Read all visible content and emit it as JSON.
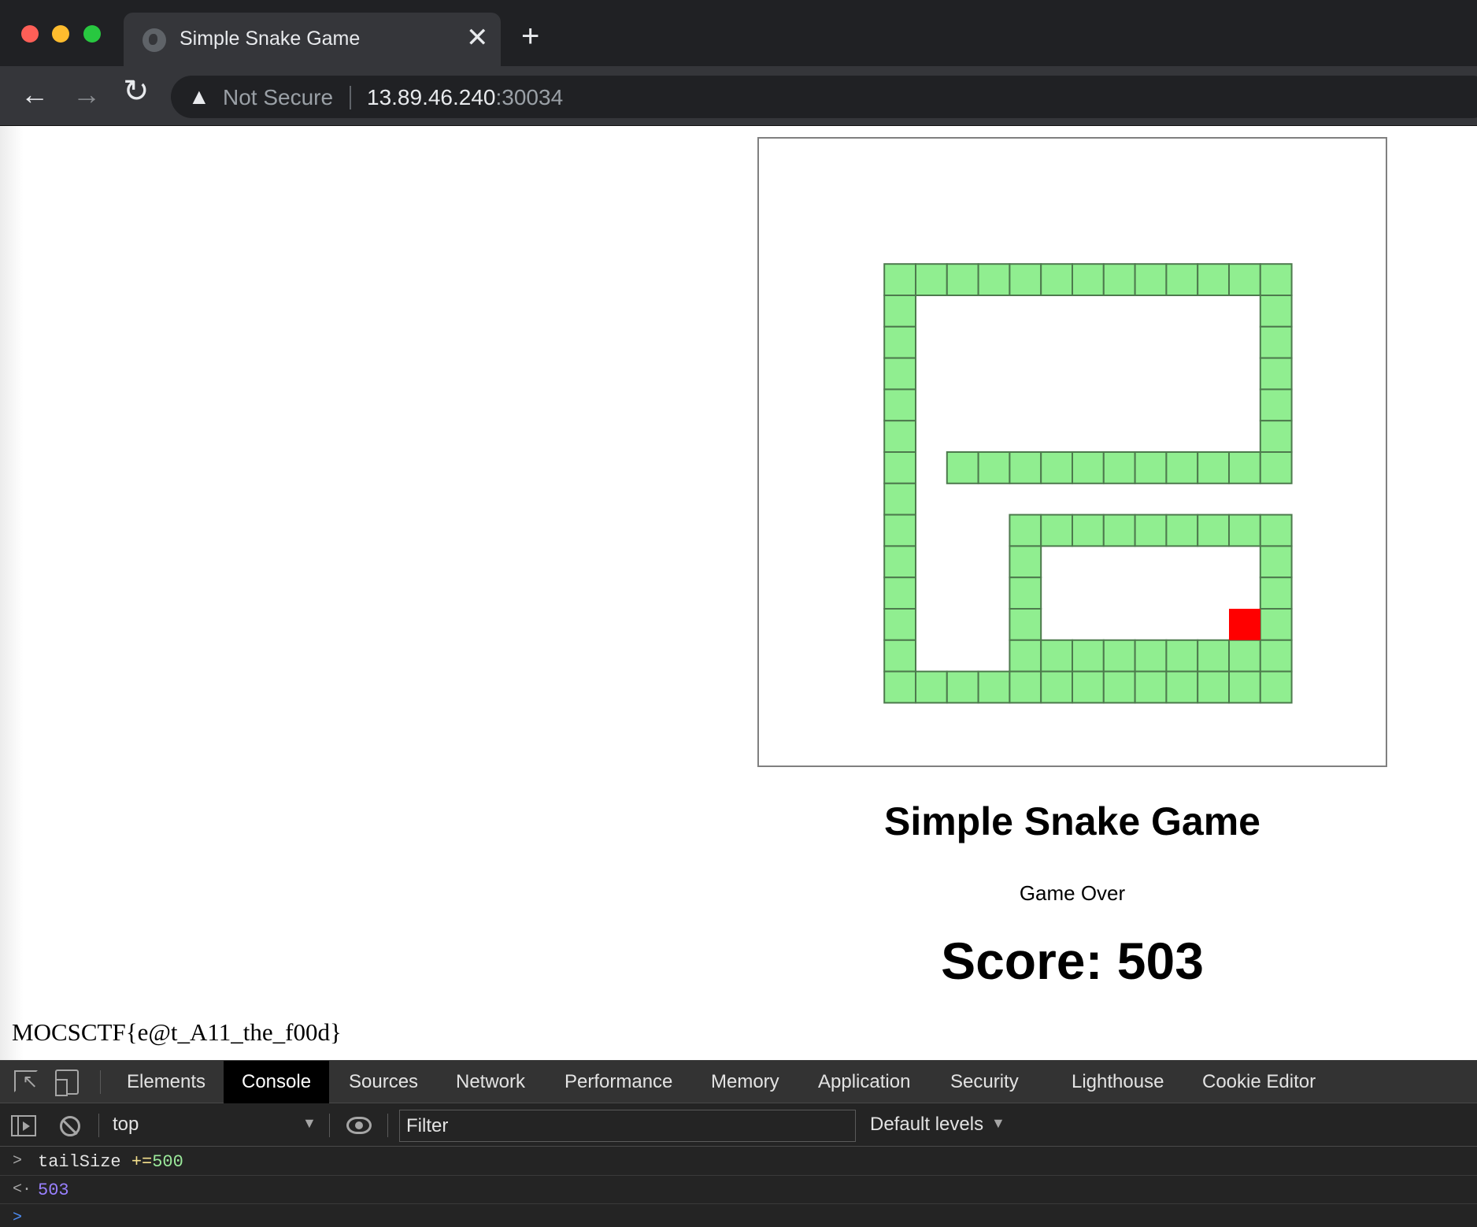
{
  "browser": {
    "tab_title": "Simple Snake Game",
    "tab_close": "✕",
    "new_tab": "+",
    "back": "←",
    "forward": "→",
    "reload": "↻",
    "warning_icon": "▲",
    "not_secure_label": "Not Secure",
    "url_host": "13.89.46.240",
    "url_port": ":30034"
  },
  "game": {
    "canvas": {
      "grid_cells": 20,
      "snake_color": "#90ee90",
      "snake_border": "#4d7a4d",
      "food_color": "#ff0000",
      "snake_cells": [
        [
          4,
          4
        ],
        [
          5,
          4
        ],
        [
          6,
          4
        ],
        [
          7,
          4
        ],
        [
          8,
          4
        ],
        [
          9,
          4
        ],
        [
          10,
          4
        ],
        [
          11,
          4
        ],
        [
          12,
          4
        ],
        [
          13,
          4
        ],
        [
          14,
          4
        ],
        [
          15,
          4
        ],
        [
          16,
          4
        ],
        [
          4,
          5
        ],
        [
          16,
          5
        ],
        [
          4,
          6
        ],
        [
          16,
          6
        ],
        [
          4,
          7
        ],
        [
          16,
          7
        ],
        [
          4,
          8
        ],
        [
          16,
          8
        ],
        [
          4,
          9
        ],
        [
          16,
          9
        ],
        [
          4,
          10
        ],
        [
          6,
          10
        ],
        [
          7,
          10
        ],
        [
          8,
          10
        ],
        [
          9,
          10
        ],
        [
          10,
          10
        ],
        [
          11,
          10
        ],
        [
          12,
          10
        ],
        [
          13,
          10
        ],
        [
          14,
          10
        ],
        [
          15,
          10
        ],
        [
          16,
          10
        ],
        [
          4,
          11
        ],
        [
          4,
          12
        ],
        [
          8,
          12
        ],
        [
          9,
          12
        ],
        [
          10,
          12
        ],
        [
          11,
          12
        ],
        [
          12,
          12
        ],
        [
          13,
          12
        ],
        [
          14,
          12
        ],
        [
          15,
          12
        ],
        [
          16,
          12
        ],
        [
          4,
          13
        ],
        [
          8,
          13
        ],
        [
          16,
          13
        ],
        [
          4,
          14
        ],
        [
          8,
          14
        ],
        [
          16,
          14
        ],
        [
          4,
          15
        ],
        [
          8,
          15
        ],
        [
          16,
          15
        ],
        [
          4,
          16
        ],
        [
          8,
          16
        ],
        [
          9,
          16
        ],
        [
          10,
          16
        ],
        [
          11,
          16
        ],
        [
          12,
          16
        ],
        [
          13,
          16
        ],
        [
          14,
          16
        ],
        [
          15,
          16
        ],
        [
          16,
          16
        ],
        [
          4,
          17
        ],
        [
          5,
          17
        ],
        [
          6,
          17
        ],
        [
          7,
          17
        ],
        [
          8,
          17
        ],
        [
          9,
          17
        ],
        [
          10,
          17
        ],
        [
          11,
          17
        ],
        [
          12,
          17
        ],
        [
          13,
          17
        ],
        [
          14,
          17
        ],
        [
          15,
          17
        ],
        [
          16,
          17
        ]
      ],
      "food_cell": [
        15,
        15
      ]
    },
    "title": "Simple Snake Game",
    "status": "Game Over",
    "score": "Score: 503"
  },
  "flag_text": "MOCSCTF{e@t_A11_the_f00d}",
  "devtools": {
    "tabs": [
      "Elements",
      "Console",
      "Sources",
      "Network",
      "Performance",
      "Memory",
      "Application",
      "Security",
      "Lighthouse",
      "Cookie Editor"
    ],
    "active_tab": "Console",
    "context": "top",
    "filter_placeholder": "Filter",
    "levels": "Default levels",
    "dropdown_arrow": "▼",
    "console": {
      "input_var": "tailSize",
      "input_op": " +=",
      "input_num": "500",
      "result": "503",
      "input_prompt": ">",
      "result_prompt": "<·",
      "cursor_prompt": ">"
    }
  }
}
